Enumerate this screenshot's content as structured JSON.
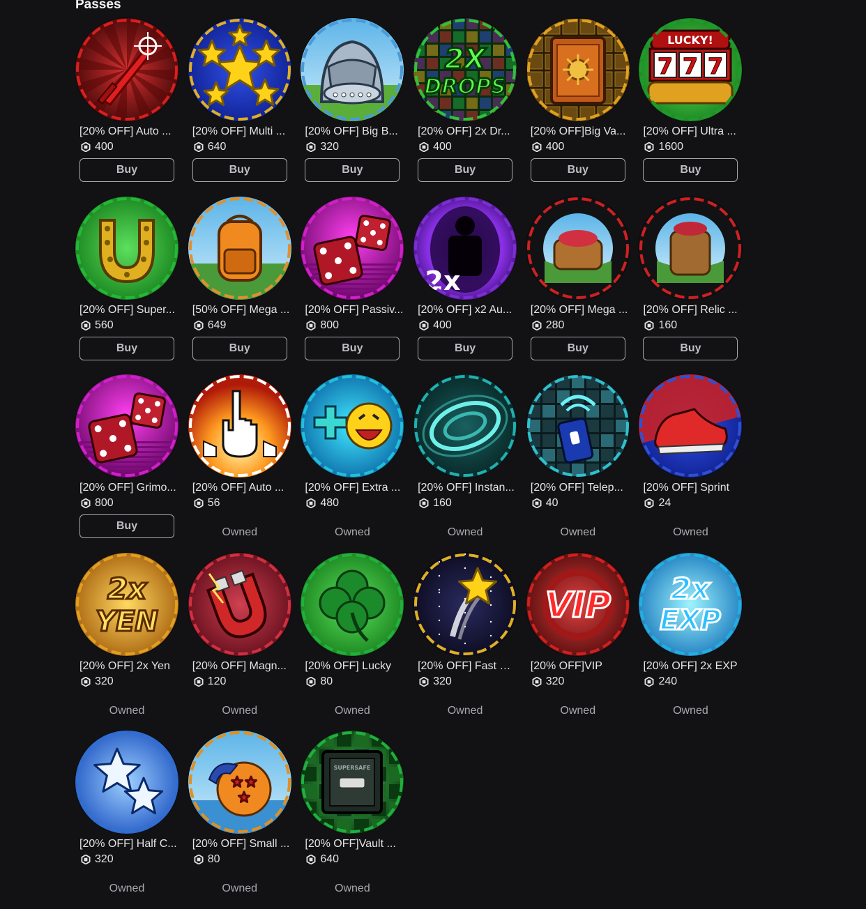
{
  "section_title": "Passes",
  "buy_label": "Buy",
  "owned_label": "Owned",
  "passes": [
    {
      "name": "[20% OFF] Auto ...",
      "price": "400",
      "status": "buy",
      "icon": "red-sword-icon",
      "ring": "#d62020"
    },
    {
      "name": "[20% OFF] Multi ...",
      "price": "640",
      "status": "buy",
      "icon": "stars-icon",
      "ring": "#e0b020"
    },
    {
      "name": "[20% OFF] Big B...",
      "price": "320",
      "status": "buy",
      "icon": "backpack-bag-icon",
      "ring": "#4a9ad8"
    },
    {
      "name": "[20% OFF] 2x Dr...",
      "price": "400",
      "status": "buy",
      "icon": "2x-drops-icon",
      "ring": "#2fc23a"
    },
    {
      "name": "[20% OFF]Big Va...",
      "price": "400",
      "status": "buy",
      "icon": "vault-safe-icon",
      "ring": "#e0a020"
    },
    {
      "name": "[20% OFF] Ultra ...",
      "price": "1600",
      "status": "buy",
      "icon": "lucky-777-slot-icon",
      "ring": "#1f9a2c"
    },
    {
      "name": "[20% OFF] Super...",
      "price": "560",
      "status": "buy",
      "icon": "horseshoe-icon",
      "ring": "#24b83a"
    },
    {
      "name": "[50% OFF] Mega ...",
      "price": "649",
      "status": "buy",
      "icon": "orange-backpack-icon",
      "ring": "#e09030"
    },
    {
      "name": "[20% OFF] Passiv...",
      "price": "800",
      "status": "buy",
      "icon": "dice-icon",
      "ring": "#d020c8"
    },
    {
      "name": "[20% OFF] x2 Au...",
      "price": "400",
      "status": "buy",
      "icon": "aura-silhouette-icon",
      "ring": "#7a30d0"
    },
    {
      "name": "[20% OFF] Mega ...",
      "price": "280",
      "status": "buy",
      "icon": "treasure-bag-icon",
      "ring": "#d02020"
    },
    {
      "name": "[20% OFF] Relic ...",
      "price": "160",
      "status": "buy",
      "icon": "relic-bag-icon",
      "ring": "#d02020"
    },
    {
      "name": "[20% OFF] Grimo...",
      "price": "800",
      "status": "buy",
      "icon": "dice-icon",
      "ring": "#d020c8"
    },
    {
      "name": "[20% OFF] Auto ...",
      "price": "56",
      "status": "owned",
      "icon": "auto-click-hands-icon",
      "ring": "#ffffff"
    },
    {
      "name": "[20% OFF] Extra ...",
      "price": "480",
      "status": "owned",
      "icon": "plus-emoji-icon",
      "ring": "#20c0d8"
    },
    {
      "name": "[20% OFF] Instan...",
      "price": "160",
      "status": "owned",
      "icon": "instant-swirl-icon",
      "ring": "#20b0b0"
    },
    {
      "name": "[20% OFF] Telep...",
      "price": "40",
      "status": "owned",
      "icon": "teleport-remote-icon",
      "ring": "#30c0d0"
    },
    {
      "name": "[20% OFF] Sprint",
      "price": "24",
      "status": "owned",
      "icon": "sneaker-icon",
      "ring": "#3050d0"
    },
    {
      "name": "[20% OFF] 2x Yen",
      "price": "320",
      "status": "owned",
      "icon": "2x-yen-icon",
      "ring": "#e0a020"
    },
    {
      "name": "[20% OFF] Magn...",
      "price": "120",
      "status": "owned",
      "icon": "magnet-icon",
      "ring": "#d03040"
    },
    {
      "name": "[20% OFF] Lucky",
      "price": "80",
      "status": "owned",
      "icon": "clover-icon",
      "ring": "#20b040"
    },
    {
      "name": "[20% OFF] Fast O...",
      "price": "320",
      "status": "owned",
      "icon": "shooting-star-icon",
      "ring": "#e0b020"
    },
    {
      "name": "[20% OFF]VIP",
      "price": "320",
      "status": "owned",
      "icon": "vip-icon",
      "ring": "#d02020"
    },
    {
      "name": "[20% OFF] 2x EXP",
      "price": "240",
      "status": "owned",
      "icon": "2x-exp-icon",
      "ring": "#20b0e0"
    },
    {
      "name": "[20% OFF] Half C...",
      "price": "320",
      "status": "owned",
      "icon": "half-stars-icon",
      "ring": "#3070d0"
    },
    {
      "name": "[20% OFF] Small ...",
      "price": "80",
      "status": "owned",
      "icon": "dragon-ball-icon",
      "ring": "#e09020"
    },
    {
      "name": "[20% OFF]Vault ...",
      "price": "640",
      "status": "owned",
      "icon": "green-vault-icon",
      "ring": "#20b040"
    }
  ],
  "art": {
    "drops_line1": "2X",
    "drops_line2": "DROPS",
    "lucky": "LUCKY!",
    "sevens": "777",
    "aura_2x": "2x",
    "yen_line1": "2x",
    "yen_line2": "YEN",
    "vip": "VIP",
    "exp_line1": "2x",
    "exp_line2": "EXP",
    "safe_label": "SUPERSAFE"
  }
}
